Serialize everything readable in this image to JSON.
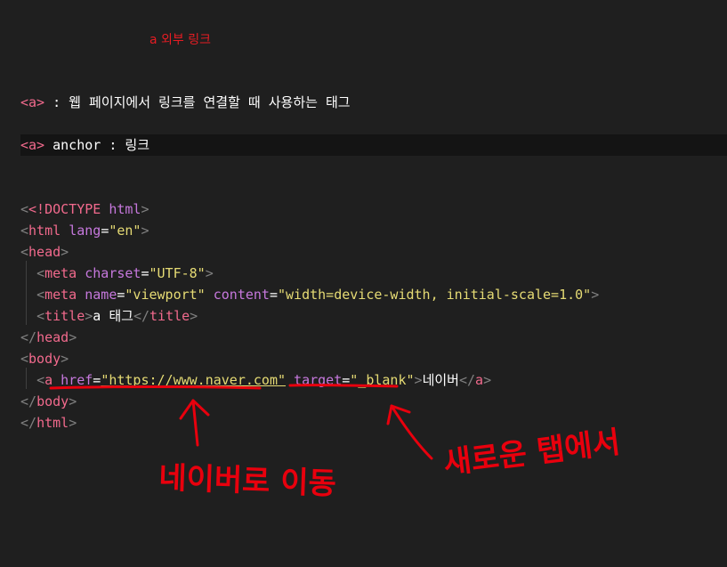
{
  "heading": "a 외부 링크",
  "desc1": {
    "tag": "<a>",
    "text": " : 웹 페이지에서 링크를 연결할 때 사용하는 태그"
  },
  "desc2": {
    "tag": "<a>",
    "text": " anchor : 링크"
  },
  "code": {
    "doctype": "<!DOCTYPE",
    "doctype_html": " html",
    "html_open": "html",
    "lang_attr": "lang",
    "lang_val": "\"en\"",
    "head": "head",
    "meta": "meta",
    "charset_attr": "charset",
    "charset_val": "\"UTF-8\"",
    "name_attr": "name",
    "name_val": "\"viewport\"",
    "content_attr": "content",
    "content_val": "\"width=device-width, initial-scale=1.0\"",
    "title": "title",
    "title_text": "a 태그",
    "body": "body",
    "a": "a",
    "href_attr": "href",
    "href_val": "\"https://www.naver.com\"",
    "target_attr": "target",
    "target_val": "\"_blank\"",
    "link_text": "네이버"
  },
  "annotations": {
    "left_note": "네이버로 이동",
    "right_note": "새로운 탭에서",
    "color": "#e8000d"
  }
}
